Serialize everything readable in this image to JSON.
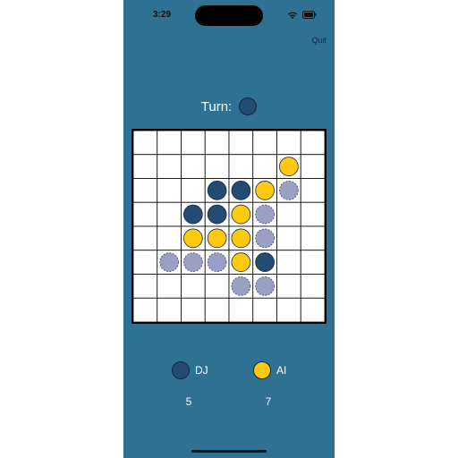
{
  "status_bar": {
    "time": "3:29",
    "icons": [
      "wifi-icon",
      "battery-icon"
    ]
  },
  "toolbar": {
    "quit_label": "Quit"
  },
  "turn": {
    "label": "Turn:",
    "current_player": "DJ"
  },
  "colors": {
    "background": "#2e7193",
    "dark_piece": "#244b73",
    "yellow_piece": "#ffc90e",
    "hint_piece": "#9a9fc4",
    "piece_outline": "#10293f",
    "board_lines": "#000000"
  },
  "board": {
    "size": 8,
    "cells": [
      [
        "empty",
        "empty",
        "empty",
        "empty",
        "empty",
        "empty",
        "empty",
        "empty"
      ],
      [
        "empty",
        "empty",
        "empty",
        "empty",
        "empty",
        "empty",
        "yellow",
        "empty"
      ],
      [
        "empty",
        "empty",
        "empty",
        "dark",
        "dark",
        "yellow",
        "hint",
        "empty"
      ],
      [
        "empty",
        "empty",
        "dark",
        "dark",
        "yellow",
        "hint",
        "empty",
        "empty"
      ],
      [
        "empty",
        "empty",
        "yellow",
        "yellow",
        "yellow",
        "hint",
        "empty",
        "empty"
      ],
      [
        "empty",
        "hint",
        "hint",
        "hint",
        "yellow",
        "dark",
        "empty",
        "empty"
      ],
      [
        "empty",
        "empty",
        "empty",
        "empty",
        "hint",
        "hint",
        "empty",
        "empty"
      ],
      [
        "empty",
        "empty",
        "empty",
        "empty",
        "empty",
        "empty",
        "empty",
        "empty"
      ]
    ]
  },
  "players": [
    {
      "name": "DJ",
      "color": "dark",
      "score": "5"
    },
    {
      "name": "AI",
      "color": "yellow",
      "score": "7"
    }
  ]
}
